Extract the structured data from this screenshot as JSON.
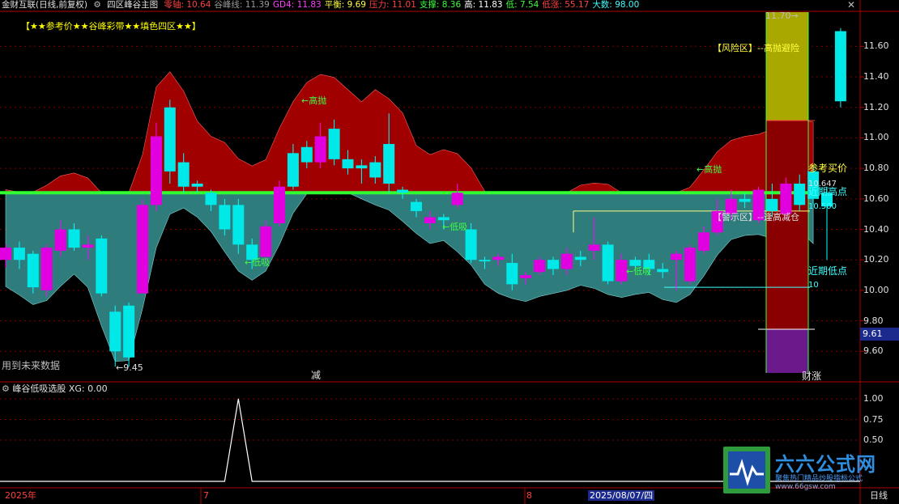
{
  "header": {
    "stock": "金财互联(日线,前复权)",
    "indicator_name": "四区峰谷主图",
    "values": [
      {
        "label": "零轴:",
        "value": "10.64",
        "color": "#ff4040"
      },
      {
        "label": "谷峰线:",
        "value": "11.39",
        "color": "#9a9a9a"
      },
      {
        "label": "GD4:",
        "value": "11.83",
        "color": "#ff40ff"
      },
      {
        "label": "平衡:",
        "value": "9.69",
        "color": "#ffff40"
      },
      {
        "label": "压力:",
        "value": "11.01",
        "color": "#ff4040"
      },
      {
        "label": "支撑:",
        "value": "8.36",
        "color": "#40ff40"
      },
      {
        "label": "高:",
        "value": "11.83",
        "color": "#ffffff"
      },
      {
        "label": "低:",
        "value": "7.54",
        "color": "#40ff40"
      },
      {
        "label": "低涨:",
        "value": "55.17",
        "color": "#ff4040"
      },
      {
        "label": "大数:",
        "value": "98.00",
        "color": "#40ffff"
      }
    ],
    "close_icon": "close-x-icon",
    "main_title": "【★★参考价★★谷峰彩带★★填色四区★★】"
  },
  "main_annotations": {
    "future_data": "用到未来数据",
    "low_marker": "←9.45",
    "high_marker": "11.70→",
    "reduce": "减",
    "cai_zhang": "财涨",
    "risk_zone": "【风险区】--高抛避险",
    "alert_zone": "【警示区】--逢高减仓",
    "ref_buy": "参考买价",
    "ref_buy_val": "10.647",
    "recent_high": "近期高点",
    "recent_high_val": "10.500",
    "recent_low": "近期低点",
    "recent_low_val": "10",
    "gaopao_labels": [
      "←高抛",
      "←高抛"
    ],
    "dixi_labels": [
      "←低吸",
      "←低吸",
      "←低吸"
    ]
  },
  "y_axis_main": {
    "ticks": [
      "11.60",
      "11.40",
      "11.20",
      "11.00",
      "10.80",
      "10.60",
      "10.40",
      "10.20",
      "10.00",
      "9.80",
      "9.60"
    ],
    "current_badge": "9.61"
  },
  "sub_panel": {
    "title": "峰谷低吸选股",
    "xg_label": "XG: 0.00",
    "ticks": [
      "1.00",
      "0.75",
      "0.50"
    ]
  },
  "x_axis": {
    "labels": [
      "2025年",
      "7",
      "8",
      "2025/08/07/四",
      "日线"
    ]
  },
  "watermark": {
    "brand": "六六公式网",
    "slogan": "聚焦热门精品炒股指标公式",
    "url": "www.66gsw.com"
  },
  "chart_data": {
    "type": "candlestick",
    "title": "四区峰谷主图",
    "ylim": [
      9.4,
      11.83
    ],
    "zero_line": 10.64,
    "candles": [
      [
        10.2,
        10.28,
        10.15,
        10.3
      ],
      [
        10.28,
        10.2,
        10.14,
        10.32
      ],
      [
        10.24,
        10.02,
        9.98,
        10.26
      ],
      [
        10.0,
        10.28,
        9.96,
        10.3
      ],
      [
        10.26,
        10.4,
        10.22,
        10.46
      ],
      [
        10.4,
        10.28,
        10.26,
        10.44
      ],
      [
        10.28,
        10.3,
        10.2,
        10.36
      ],
      [
        10.34,
        9.98,
        9.96,
        10.36
      ],
      [
        9.86,
        9.6,
        9.5,
        9.9
      ],
      [
        9.9,
        9.56,
        9.5,
        9.92
      ],
      [
        9.98,
        10.56,
        9.98,
        10.6
      ],
      [
        10.56,
        11.01,
        10.52,
        11.1
      ],
      [
        11.2,
        10.78,
        10.7,
        11.25
      ],
      [
        10.84,
        10.68,
        10.64,
        10.9
      ],
      [
        10.7,
        10.68,
        10.64,
        10.72
      ],
      [
        10.64,
        10.56,
        10.52,
        10.66
      ],
      [
        10.56,
        10.4,
        10.36,
        10.6
      ],
      [
        10.56,
        10.3,
        10.24,
        10.6
      ],
      [
        10.3,
        10.2,
        10.14,
        10.34
      ],
      [
        10.22,
        10.42,
        10.18,
        10.46
      ],
      [
        10.44,
        10.68,
        10.42,
        10.72
      ],
      [
        10.9,
        10.68,
        10.66,
        10.96
      ],
      [
        10.94,
        10.84,
        10.8,
        10.98
      ],
      [
        10.84,
        11.01,
        10.8,
        11.1
      ],
      [
        11.06,
        10.86,
        10.82,
        11.12
      ],
      [
        10.86,
        10.8,
        10.76,
        10.92
      ],
      [
        10.82,
        10.8,
        10.7,
        10.86
      ],
      [
        10.84,
        10.74,
        10.7,
        10.88
      ],
      [
        10.96,
        10.7,
        10.64,
        11.16
      ],
      [
        10.66,
        10.64,
        10.6,
        10.68
      ],
      [
        10.58,
        10.52,
        10.48,
        10.6
      ],
      [
        10.44,
        10.48,
        10.4,
        10.52
      ],
      [
        10.48,
        10.46,
        10.4,
        10.5
      ],
      [
        10.56,
        10.64,
        10.54,
        10.7
      ],
      [
        10.4,
        10.2,
        10.18,
        10.44
      ],
      [
        10.2,
        10.19,
        10.14,
        10.22
      ],
      [
        10.2,
        10.22,
        10.16,
        10.24
      ],
      [
        10.18,
        10.04,
        10.0,
        10.24
      ],
      [
        10.08,
        10.1,
        10.04,
        10.12
      ],
      [
        10.12,
        10.2,
        10.1,
        10.22
      ],
      [
        10.2,
        10.14,
        10.1,
        10.22
      ],
      [
        10.14,
        10.24,
        10.1,
        10.28
      ],
      [
        10.22,
        10.2,
        10.16,
        10.26
      ],
      [
        10.26,
        10.3,
        10.2,
        10.48
      ],
      [
        10.3,
        10.06,
        10.04,
        10.32
      ],
      [
        10.06,
        10.2,
        10.04,
        10.24
      ],
      [
        10.2,
        10.16,
        10.14,
        10.22
      ],
      [
        10.2,
        10.14,
        10.1,
        10.24
      ],
      [
        10.14,
        10.12,
        10.08,
        10.18
      ],
      [
        10.2,
        10.24,
        10.0,
        10.26
      ],
      [
        10.06,
        10.28,
        10.04,
        10.3
      ],
      [
        10.26,
        10.38,
        10.24,
        10.42
      ],
      [
        10.38,
        10.52,
        10.36,
        10.6
      ],
      [
        10.5,
        10.6,
        10.46,
        10.66
      ],
      [
        10.6,
        10.58,
        10.54,
        10.64
      ],
      [
        10.46,
        10.66,
        10.44,
        10.68
      ],
      [
        10.6,
        10.52,
        10.48,
        10.7
      ],
      [
        10.5,
        10.7,
        10.46,
        10.74
      ],
      [
        10.7,
        10.56,
        10.52,
        10.76
      ],
      [
        10.78,
        10.6,
        10.56,
        10.82
      ],
      [
        10.64,
        10.55,
        10.2,
        10.68
      ],
      [
        11.7,
        11.24,
        11.2,
        11.72
      ]
    ],
    "xg_signal": [
      0,
      0,
      0,
      0,
      0,
      0,
      0,
      0,
      0,
      0,
      0,
      0,
      0,
      0,
      0,
      0,
      0,
      1,
      0,
      0,
      0,
      0,
      0,
      0,
      0,
      0,
      0,
      0,
      0,
      0,
      0,
      0,
      0,
      0,
      0,
      0,
      0,
      0,
      0,
      0,
      0,
      0,
      0,
      0,
      0,
      0,
      0,
      0,
      0,
      0,
      0,
      0,
      0,
      0,
      0,
      0,
      0,
      0,
      0,
      0,
      0,
      0
    ]
  }
}
